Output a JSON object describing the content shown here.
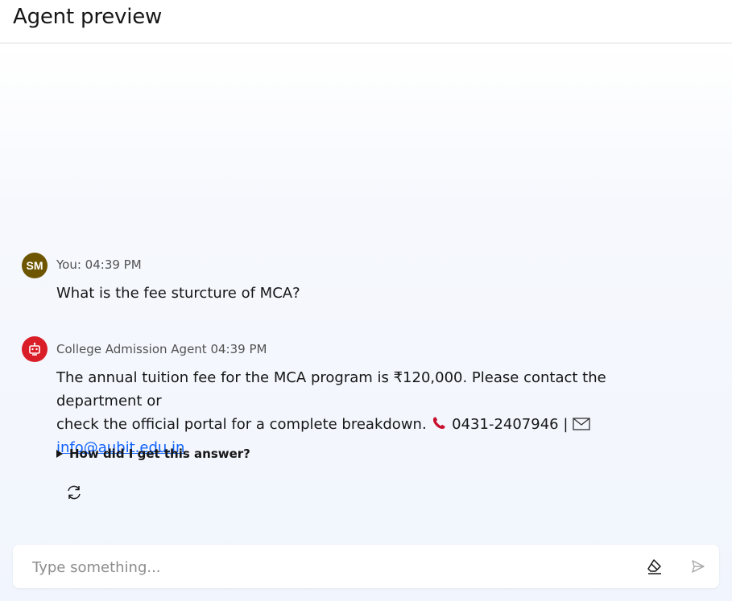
{
  "header": {
    "title": "Agent preview"
  },
  "messages": [
    {
      "role": "user",
      "avatar_initials": "SM",
      "meta": "You: 04:39 PM",
      "text": "What is the fee sturcture of MCA?"
    },
    {
      "role": "agent",
      "avatar_icon": "robot-icon",
      "meta": "College Admission Agent 04:39 PM",
      "text_line1": "The annual tuition fee for the MCA program is ₹120,000. Please contact the department or",
      "text_line2": "check the official portal for a complete breakdown.",
      "phone": "0431-2407946 |",
      "email": "info@aubit.edu.in",
      "disclosure_label": "How did I get this answer?"
    }
  ],
  "input": {
    "placeholder": "Type something..."
  },
  "icons": {
    "clear": "eraser-icon",
    "send": "send-icon",
    "regenerate": "refresh-icon"
  },
  "colors": {
    "user_avatar": "#6e5600",
    "agent_avatar": "#da1e28",
    "link": "#0f62fe"
  }
}
